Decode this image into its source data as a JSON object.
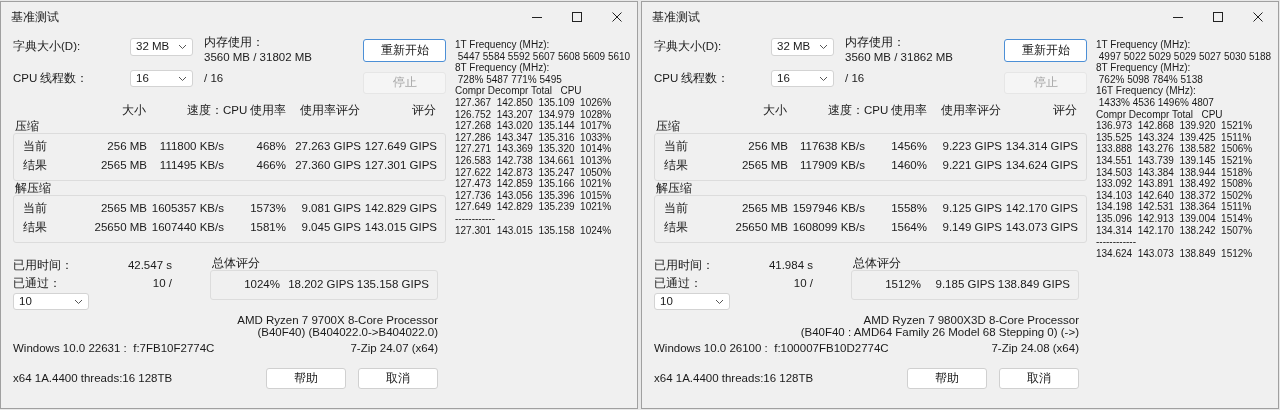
{
  "windows": [
    {
      "title": "基准测试",
      "dictionary": {
        "label": "字典大小(D):",
        "value": "32 MB"
      },
      "memory": {
        "label": "内存使用：",
        "value": "3560 MB / 31802 MB"
      },
      "threads": {
        "label": "CPU 线程数：",
        "value": "16",
        "max": "/ 16"
      },
      "buttons": [
        {
          "label": "重新开始",
          "disabled": false
        },
        {
          "label": "停止",
          "disabled": true
        }
      ],
      "columns": [
        "大小",
        "速度：",
        "CPU 使用率",
        "使用率评分",
        "评分"
      ],
      "groups": [
        {
          "label": "压缩",
          "rows": [
            {
              "label": "当前",
              "cells": [
                "256 MB",
                "111800 KB/s",
                "468%",
                "27.263 GIPS",
                "127.649 GIPS"
              ]
            },
            {
              "label": "结果",
              "cells": [
                "2565 MB",
                "111495 KB/s",
                "466%",
                "27.360 GIPS",
                "127.301 GIPS"
              ]
            }
          ]
        },
        {
          "label": "解压缩",
          "rows": [
            {
              "label": "当前",
              "cells": [
                "2565 MB",
                "1605357 KB/s",
                "1573%",
                "9.081 GIPS",
                "142.829 GIPS"
              ]
            },
            {
              "label": "结果",
              "cells": [
                "25650 MB",
                "1607440 KB/s",
                "1581%",
                "9.045 GIPS",
                "143.015 GIPS"
              ]
            }
          ]
        }
      ],
      "elapsed": {
        "label": "已用时间：",
        "value": "42.547 s"
      },
      "passes": {
        "label": "已通过：",
        "value": "10 /",
        "select": "10"
      },
      "total": {
        "label": "总体评分",
        "values": [
          "1024%",
          "18.202 GIPS",
          "135.158 GIPS"
        ]
      },
      "cpu": [
        "AMD Ryzen 7 9700X 8-Core Processor",
        "(B40F40) (B404022.0->B404022.0)"
      ],
      "os": "Windows 10.0 22631 :  f:7FB10F2774C",
      "version": "7-Zip 24.07 (x64)",
      "system": "x64 1A.4400 threads:16 128TB",
      "dialog_buttons": [
        "帮助",
        "取消"
      ],
      "log": [
        "1T Frequency (MHz):",
        " 5447 5584 5592 5607 5608 5609 5610",
        "8T Frequency (MHz):",
        " 728% 5487 771% 5495",
        "Compr Decompr Total   CPU",
        "127.367  142.850  135.109  1026%",
        "126.752  143.207  134.979  1028%",
        "127.268  143.020  135.144  1017%",
        "127.286  143.347  135.316  1033%",
        "127.271  143.369  135.320  1014%",
        "126.583  142.738  134.661  1013%",
        "127.622  142.873  135.247  1050%",
        "127.473  142.859  135.166  1021%",
        "127.736  143.056  135.396  1015%",
        "127.649  142.829  135.239  1021%",
        "------------",
        "127.301  143.015  135.158  1024%"
      ]
    },
    {
      "title": "基准测试",
      "dictionary": {
        "label": "字典大小(D):",
        "value": "32 MB"
      },
      "memory": {
        "label": "内存使用：",
        "value": "3560 MB / 31862 MB"
      },
      "threads": {
        "label": "CPU 线程数：",
        "value": "16",
        "max": "/ 16"
      },
      "buttons": [
        {
          "label": "重新开始",
          "disabled": false
        },
        {
          "label": "停止",
          "disabled": true
        }
      ],
      "columns": [
        "大小",
        "速度：",
        "CPU 使用率",
        "使用率评分",
        "评分"
      ],
      "groups": [
        {
          "label": "压缩",
          "rows": [
            {
              "label": "当前",
              "cells": [
                "256 MB",
                "117638 KB/s",
                "1456%",
                "9.223 GIPS",
                "134.314 GIPS"
              ]
            },
            {
              "label": "结果",
              "cells": [
                "2565 MB",
                "117909 KB/s",
                "1460%",
                "9.221 GIPS",
                "134.624 GIPS"
              ]
            }
          ]
        },
        {
          "label": "解压缩",
          "rows": [
            {
              "label": "当前",
              "cells": [
                "2565 MB",
                "1597946 KB/s",
                "1558%",
                "9.125 GIPS",
                "142.170 GIPS"
              ]
            },
            {
              "label": "结果",
              "cells": [
                "25650 MB",
                "1608099 KB/s",
                "1564%",
                "9.149 GIPS",
                "143.073 GIPS"
              ]
            }
          ]
        }
      ],
      "elapsed": {
        "label": "已用时间：",
        "value": "41.984 s"
      },
      "passes": {
        "label": "已通过：",
        "value": "10 /",
        "select": "10"
      },
      "total": {
        "label": "总体评分",
        "values": [
          "1512%",
          "9.185 GIPS",
          "138.849 GIPS"
        ]
      },
      "cpu": [
        "AMD Ryzen 7 9800X3D 8-Core Processor",
        "(B40F40 : AMD64 Family 26 Model 68 Stepping 0) (->)"
      ],
      "os": "Windows 10.0 26100 :  f:100007FB10D2774C",
      "version": "7-Zip 24.08 (x64)",
      "system": "x64 1A.4400 threads:16 128TB",
      "dialog_buttons": [
        "帮助",
        "取消"
      ],
      "log": [
        "1T Frequency (MHz):",
        " 4997 5022 5029 5029 5027 5030 5188",
        "8T Frequency (MHz):",
        " 762% 5098 784% 5138",
        "16T Frequency (MHz):",
        " 1433% 4536 1496% 4807",
        "Compr Decompr Total   CPU",
        "136.973  142.868  139.920  1521%",
        "135.525  143.324  139.425  1511%",
        "133.888  143.276  138.582  1506%",
        "134.551  143.739  139.145  1521%",
        "134.503  143.384  138.944  1518%",
        "133.092  143.891  138.492  1508%",
        "134.103  142.640  138.372  1502%",
        "134.198  142.531  138.364  1511%",
        "135.096  142.913  139.004  1514%",
        "134.314  142.170  138.242  1507%",
        "------------",
        "134.624  143.073  138.849  1512%"
      ]
    }
  ]
}
